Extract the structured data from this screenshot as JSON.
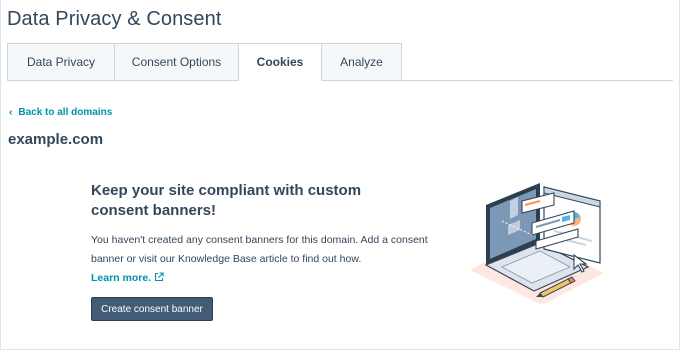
{
  "page": {
    "title": "Data Privacy & Consent"
  },
  "tabs": [
    {
      "label": "Data Privacy",
      "active": false
    },
    {
      "label": "Consent Options",
      "active": false
    },
    {
      "label": "Cookies",
      "active": true
    },
    {
      "label": "Analyze",
      "active": false
    }
  ],
  "back_link": {
    "label": "Back to all domains",
    "icon": "chevron-left-icon"
  },
  "domain": {
    "name": "example.com"
  },
  "empty_state": {
    "heading": "Keep your site compliant with custom consent banners!",
    "body": "You haven't created any consent banners for this domain. Add a consent banner or visit our Knowledge Base article to find out how.",
    "learn_more": "Learn more.",
    "learn_more_icon": "external-link-icon",
    "button_label": "Create consent banner",
    "illustration": "laptop-consent-banner-illustration"
  },
  "colors": {
    "text": "#33475b",
    "link": "#0091ae",
    "button": "#425b76",
    "tab_inactive_bg": "#f5f8fa",
    "border": "#cbd6e2",
    "accent_orange": "#ff7a59"
  }
}
